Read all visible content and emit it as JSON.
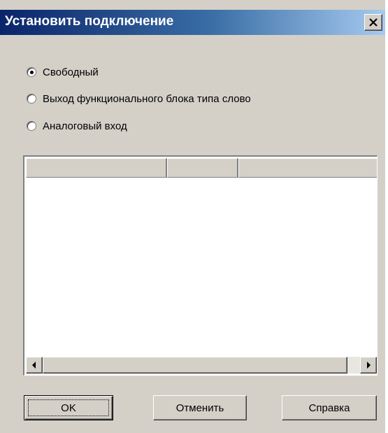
{
  "dialog": {
    "title": "Установить подключение",
    "close_label": "×"
  },
  "connection_options": [
    {
      "label": "Свободный",
      "checked": true
    },
    {
      "label": "Выход функционального блока типа слово",
      "checked": false
    },
    {
      "label": "Аналоговый вход",
      "checked": false
    }
  ],
  "list": {
    "columns": [
      "",
      "",
      ""
    ],
    "rows": []
  },
  "buttons": {
    "ok": "OK",
    "cancel": "Отменить",
    "help": "Справка"
  },
  "colors": {
    "title_gradient_start": "#0a246a",
    "title_gradient_end": "#a6caf0",
    "face": "#d4d0c8"
  }
}
